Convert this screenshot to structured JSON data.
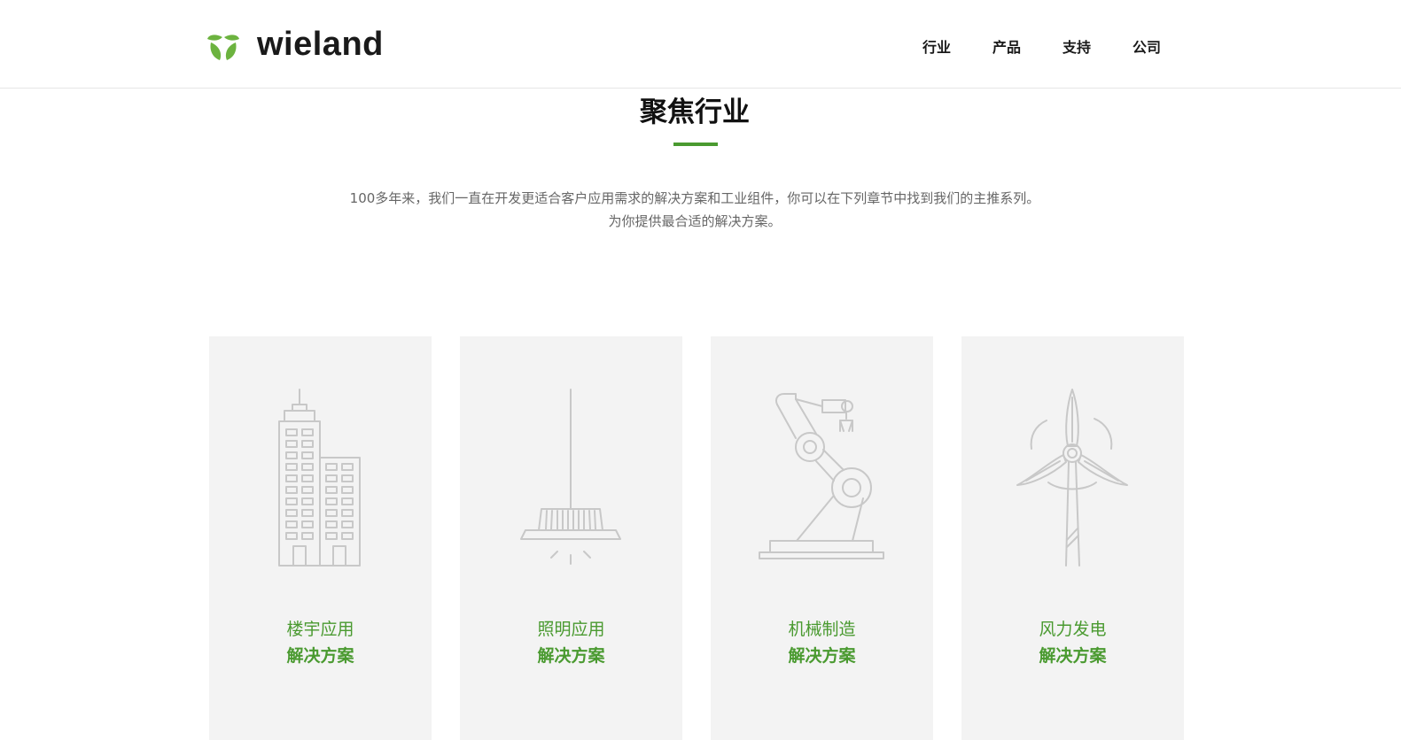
{
  "header": {
    "logo_text": "wieland",
    "logo_mark_letter": "W",
    "nav": [
      {
        "label": "行业"
      },
      {
        "label": "产品"
      },
      {
        "label": "支持"
      },
      {
        "label": "公司"
      }
    ]
  },
  "section": {
    "title": "聚焦行业",
    "intro_line1": "100多年来，我们一直在开发更适合客户应用需求的解决方案和工业组件，你可以在下列章节中找到我们的主推系列。",
    "intro_line2": "为你提供最合适的解决方案。"
  },
  "cards": [
    {
      "title": "楼宇应用",
      "subtitle": "解决方案",
      "icon": "building-icon"
    },
    {
      "title": "照明应用",
      "subtitle": "解决方案",
      "icon": "pendant-lamp-icon"
    },
    {
      "title": "机械制造",
      "subtitle": "解决方案",
      "icon": "robot-arm-icon"
    },
    {
      "title": "风力发电",
      "subtitle": "解决方案",
      "icon": "wind-turbine-icon"
    }
  ],
  "colors": {
    "accent": "#4a9a30",
    "card_bg": "#f3f3f3",
    "icon_stroke": "#c8c8c8",
    "text_dark": "#111111",
    "text_muted": "#666666"
  }
}
